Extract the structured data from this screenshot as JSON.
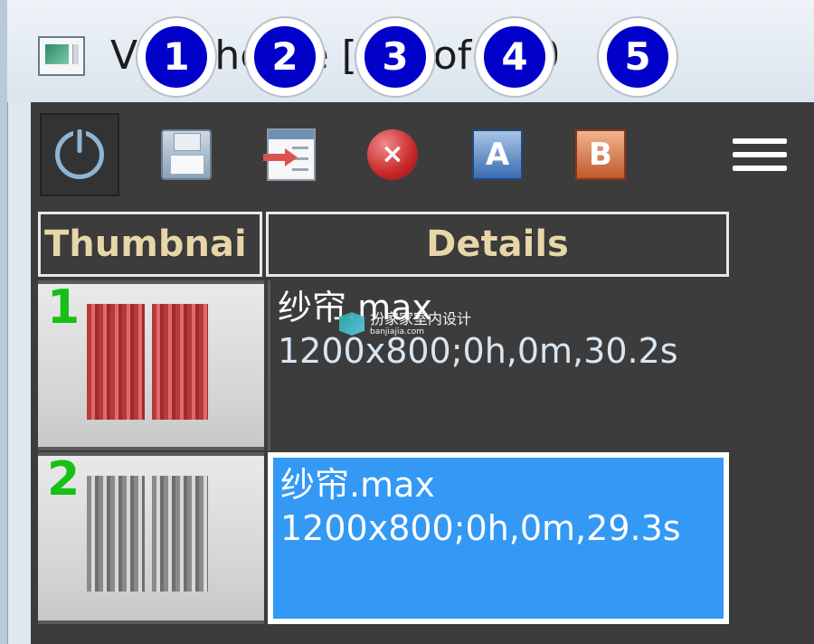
{
  "window": {
    "title": "Vray framebuffer [1 of 120",
    "title_visible": "V    y t     he   ffe     [1     5 of 120"
  },
  "callouts": [
    "1",
    "2",
    "3",
    "4",
    "5"
  ],
  "toolbar": {
    "buttons": [
      {
        "icon": "power-icon"
      },
      {
        "icon": "save-icon"
      },
      {
        "icon": "load-icon"
      },
      {
        "icon": "delete-icon"
      },
      {
        "icon": "compare-a-icon",
        "letter": "A"
      },
      {
        "icon": "compare-b-icon",
        "letter": "B"
      }
    ],
    "menu_icon": "hamburger-menu-icon"
  },
  "table": {
    "columns": [
      "Thumbnai",
      "Details"
    ],
    "rows": [
      {
        "index": "1",
        "name": "纱帘.max",
        "info": "1200x800;0h,0m,30.2s",
        "thumb": "red",
        "selected": false
      },
      {
        "index": "2",
        "name": "纱帘.max",
        "info": "1200x800;0h,0m,29.3s",
        "thumb": "gray",
        "selected": true
      }
    ]
  },
  "watermark": {
    "main": "扮家家室内设计",
    "sub": "banjiajia.com"
  },
  "colors": {
    "panel_bg": "#3c3c3c",
    "selection": "#3399f5",
    "callout_fill": "#0000c8",
    "header_text": "#e6d6a8",
    "row_number": "#16c016"
  }
}
